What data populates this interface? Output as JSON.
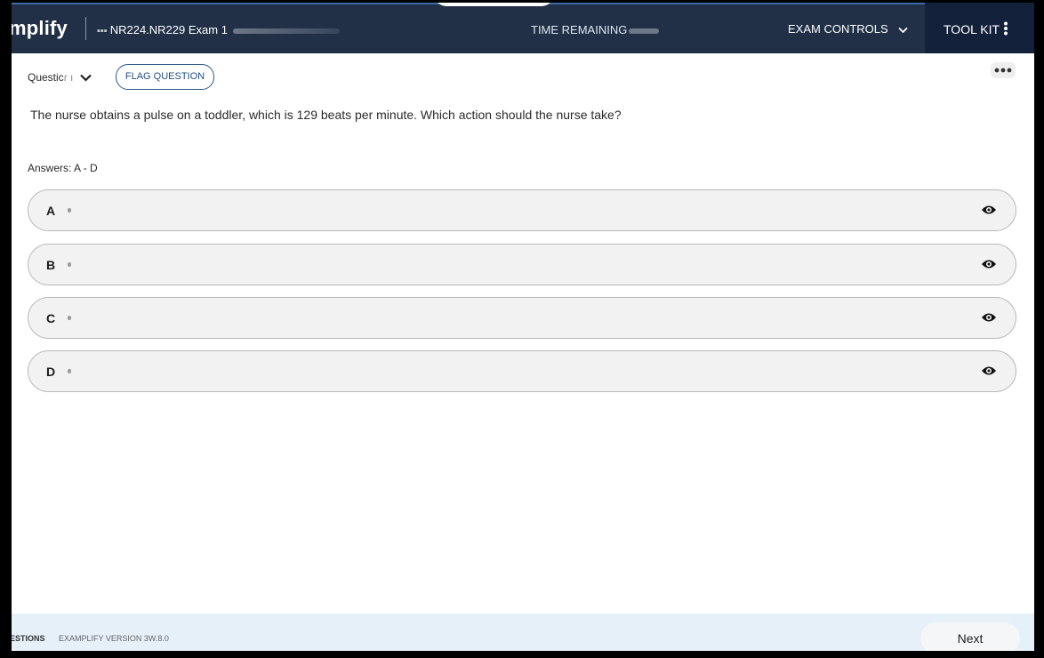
{
  "header": {
    "logo_text": "mplify",
    "exam_title": "NR224.NR229 Exam 1",
    "time_remaining_label": "TIME REMAINING",
    "exam_controls_label": "EXAM CONTROLS",
    "toolkit_label": "TOOL KIT"
  },
  "question": {
    "selector_label": "Questic",
    "flag_label": "FLAG QUESTION",
    "text": "The nurse obtains a pulse on a toddler, which is 129 beats per minute. Which action should the nurse take?",
    "answers_label": "Answers: A - D",
    "options": [
      {
        "letter": "A"
      },
      {
        "letter": "B"
      },
      {
        "letter": "C"
      },
      {
        "letter": "D"
      }
    ]
  },
  "footer": {
    "questions_label": "ESTIONS",
    "version_label": "EXAMPLIFY VERSION 3W.8.0",
    "next_label": "Next"
  },
  "colors": {
    "header_bg": "#213047",
    "toolkit_bg": "#14213a",
    "accent": "#1f4f82",
    "option_bg": "#f2f2f2",
    "footer_bg": "#e6f0f8"
  },
  "icons": {
    "exam_controls": "chevron-down-icon",
    "toolkit": "vertical-dots-icon",
    "question_selector": "chevron-down-icon",
    "more": "horizontal-dots-icon",
    "option_action": "eye-icon"
  }
}
